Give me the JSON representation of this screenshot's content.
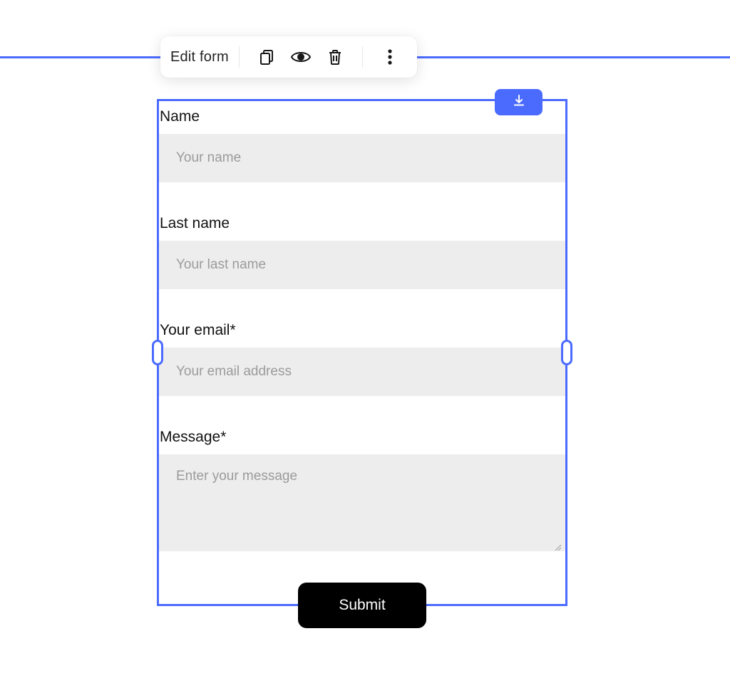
{
  "toolbar": {
    "title": "Edit form"
  },
  "form": {
    "fields": {
      "name": {
        "label": "Name",
        "placeholder": "Your name"
      },
      "lastName": {
        "label": "Last name",
        "placeholder": "Your last name"
      },
      "email": {
        "label": "Your email*",
        "placeholder": "Your email address"
      },
      "message": {
        "label": "Message*",
        "placeholder": "Enter your message"
      }
    },
    "submit_label": "Submit"
  },
  "colors": {
    "accent": "#4b6bff",
    "input_bg": "#ededed",
    "placeholder": "#9b9b9b",
    "button_bg": "#000000"
  }
}
